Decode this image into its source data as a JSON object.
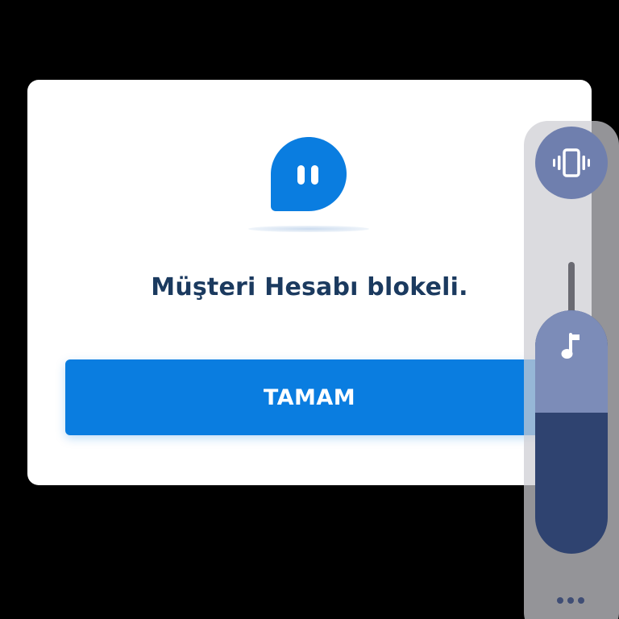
{
  "dialog": {
    "message": "Müşteri Hesabı blokeli.",
    "ok_button_label": "TAMAM",
    "icon": "paused-chat-bubble-icon",
    "accent_color": "#0a7de0",
    "text_color": "#1b3a5f"
  },
  "volume_panel": {
    "vibrate_icon": "vibrate-icon",
    "media_icon": "music-note-icon",
    "more_icon": "more-dots-icon",
    "media_volume_fraction": 0.58
  }
}
